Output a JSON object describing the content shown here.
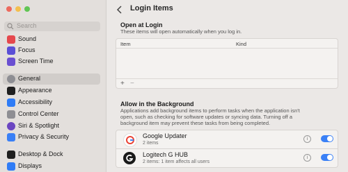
{
  "sidebar": {
    "search_placeholder": "Search",
    "items": [
      {
        "label": "Sound",
        "icon": "speaker-icon",
        "color": "#e5484d"
      },
      {
        "label": "Focus",
        "icon": "moon-icon",
        "color": "#5b4fd6"
      },
      {
        "label": "Screen Time",
        "icon": "hourglass-icon",
        "color": "#6a4fd1"
      },
      {
        "label": "General",
        "icon": "gear-icon",
        "color": "#8e8e93",
        "selected": true
      },
      {
        "label": "Appearance",
        "icon": "appearance-icon",
        "color": "#1f1f1f"
      },
      {
        "label": "Accessibility",
        "icon": "accessibility-icon",
        "color": "#2f7cf6"
      },
      {
        "label": "Control Center",
        "icon": "control-center-icon",
        "color": "#8e8e93"
      },
      {
        "label": "Siri & Spotlight",
        "icon": "siri-icon",
        "color": "#6b46c1"
      },
      {
        "label": "Privacy & Security",
        "icon": "hand-icon",
        "color": "#3a80f6"
      },
      {
        "label": "Desktop & Dock",
        "icon": "dock-icon",
        "color": "#1f1f1f"
      },
      {
        "label": "Displays",
        "icon": "display-icon",
        "color": "#2f7cf6"
      }
    ]
  },
  "header": {
    "title": "Login Items"
  },
  "open_at_login": {
    "title": "Open at Login",
    "subtitle": "These items will open automatically when you log in.",
    "columns": [
      "Item",
      "Kind"
    ],
    "add_label": "+",
    "remove_label": "−"
  },
  "background": {
    "title": "Allow in the Background",
    "subtitle_lines": [
      "Applications add background items to perform tasks when the application isn't",
      "open, such as checking for software updates or syncing data. Turning off a",
      "background item may prevent these tasks from being completed."
    ],
    "items": [
      {
        "name": "Google Updater",
        "sub": "2 items",
        "icon": "google-updater-icon",
        "enabled": true
      },
      {
        "name": "Logitech G HUB",
        "sub": "2 items: 1 item affects all users",
        "icon": "logitech-g-hub-icon",
        "enabled": true
      }
    ]
  },
  "colors": {
    "accent": "#3a80f6"
  }
}
